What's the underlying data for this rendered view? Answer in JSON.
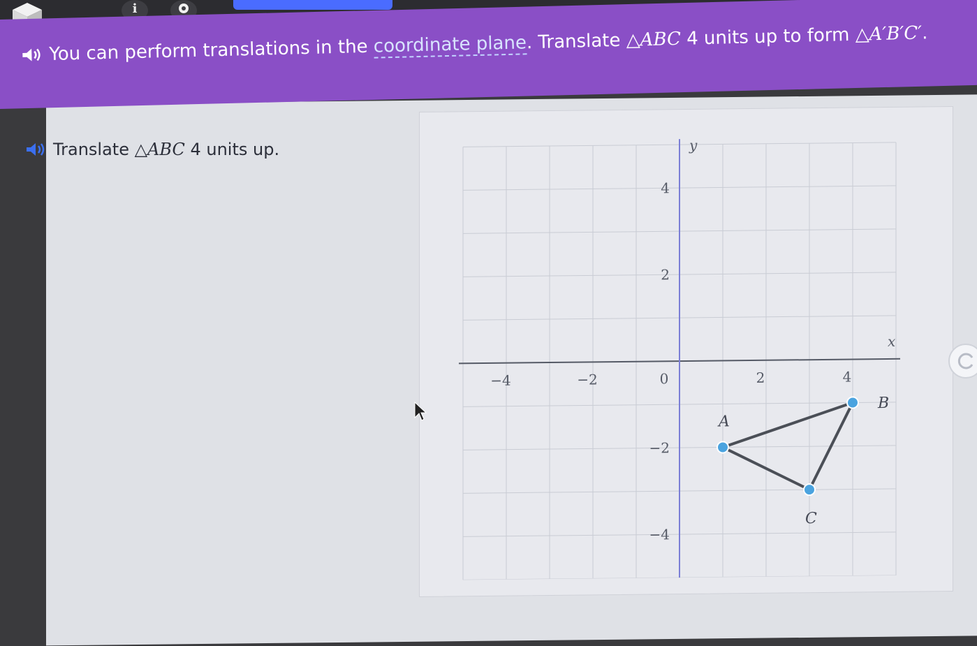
{
  "toolbar": {
    "info_label": "i"
  },
  "banner": {
    "text_before_link": "You can perform translations in the ",
    "link_text": "coordinate plane",
    "text_after_link": ". Translate ",
    "triangle": "△ABC",
    "text_middle": " 4 units up to form ",
    "image_triangle": "△A′B′C′",
    "text_end": "."
  },
  "task": {
    "prefix": "Translate ",
    "triangle": "△ABC",
    "suffix": " 4 units up."
  },
  "colors": {
    "banner": "#8a4fc6",
    "point": "#4aa3df",
    "segment": "#4b4f57",
    "axis": "#7b7fd6"
  },
  "chart_data": {
    "type": "scatter",
    "xlabel": "x",
    "ylabel": "y",
    "xlim": [
      -5,
      5
    ],
    "ylim": [
      -5,
      5
    ],
    "grid": true,
    "x_ticks": [
      -4,
      -2,
      0,
      2,
      4
    ],
    "y_ticks": [
      -4,
      -2,
      2,
      4
    ],
    "x_tick_labels": [
      "−4",
      "−2",
      "0",
      "2",
      "4"
    ],
    "y_tick_labels": [
      "−4",
      "−2",
      "2",
      "4"
    ],
    "points": [
      {
        "name": "A",
        "x": 1,
        "y": -2
      },
      {
        "name": "B",
        "x": 4,
        "y": -1
      },
      {
        "name": "C",
        "x": 3,
        "y": -3
      }
    ],
    "segments": [
      [
        "A",
        "B"
      ],
      [
        "B",
        "C"
      ],
      [
        "C",
        "A"
      ]
    ]
  }
}
